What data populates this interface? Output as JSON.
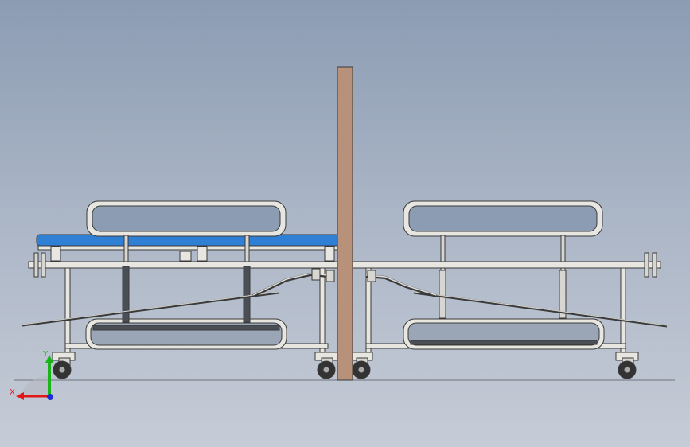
{
  "triad": {
    "x_label": "X",
    "y_label": "Y",
    "x_color": "#e01818",
    "y_color": "#18b418",
    "z_color": "#1c2cd8"
  },
  "colors": {
    "background_top": "#8c9cb3",
    "background_bottom": "#c6ccd7",
    "mattress": "#2f7fd4",
    "frame": "#e8e6e0",
    "post": "#b8917a",
    "outline": "#3a3a3a"
  }
}
